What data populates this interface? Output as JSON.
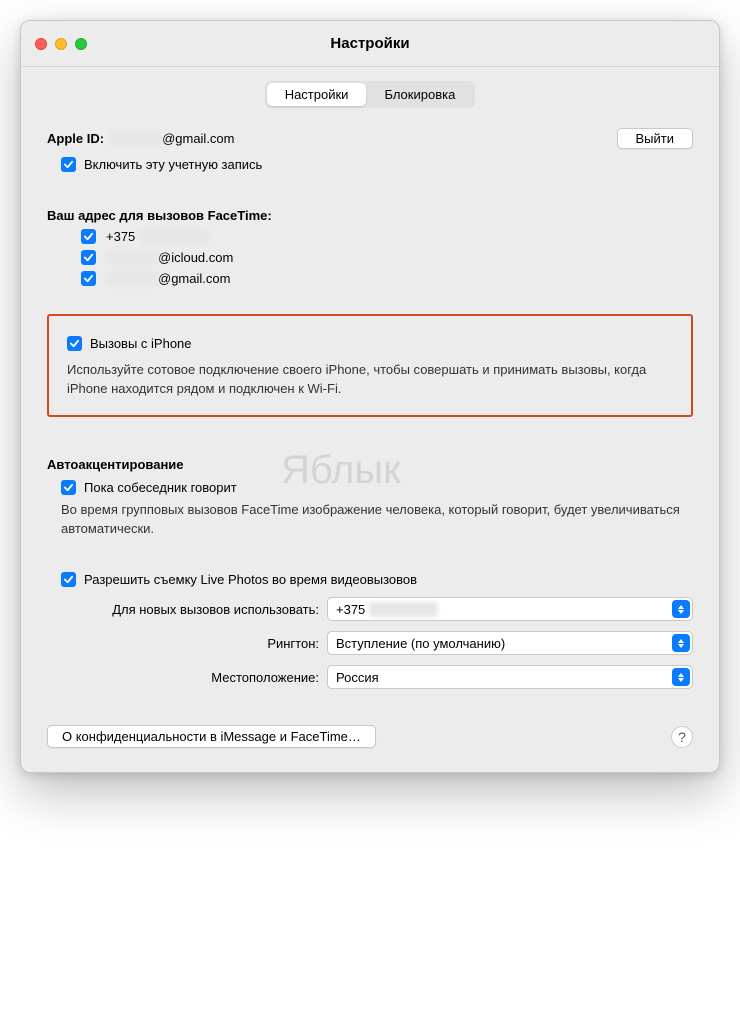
{
  "window": {
    "title": "Настройки"
  },
  "tabs": {
    "settings": "Настройки",
    "block": "Блокировка"
  },
  "account": {
    "apple_id_label": "Apple ID:",
    "apple_id_value": "@gmail.com",
    "redacted_prefix": "xxxxxxxx",
    "signout": "Выйти",
    "enable_label": "Включить эту учетную запись"
  },
  "addresses": {
    "header": "Ваш адрес для вызовов FaceTime:",
    "items": [
      {
        "prefix": "+375",
        "suffix": ""
      },
      {
        "prefix": "",
        "suffix": "@icloud.com"
      },
      {
        "prefix": "",
        "suffix": "@gmail.com"
      }
    ]
  },
  "calls": {
    "label": "Вызовы с iPhone",
    "desc": "Используйте сотовое подключение своего iPhone, чтобы совершать и принимать вызовы, когда iPhone находится рядом и подключен к Wi-Fi."
  },
  "watermark": "Яблык",
  "autofocus": {
    "header": "Автоакцентирование",
    "label": "Пока собеседник говорит",
    "desc": "Во время групповых вызовов FaceTime изображение человека, который говорит, будет увеличиваться автоматически."
  },
  "live_photos": {
    "label": "Разрешить съемку Live Photos во время видеовызовов"
  },
  "dropdowns": {
    "new_calls_label": "Для новых вызовов использовать:",
    "new_calls_value": "+375",
    "ringtone_label": "Рингтон:",
    "ringtone_value": "Вступление (по умолчанию)",
    "location_label": "Местоположение:",
    "location_value": "Россия"
  },
  "footer": {
    "privacy": "О конфиденциальности в iMessage и FaceTime…",
    "help": "?"
  }
}
